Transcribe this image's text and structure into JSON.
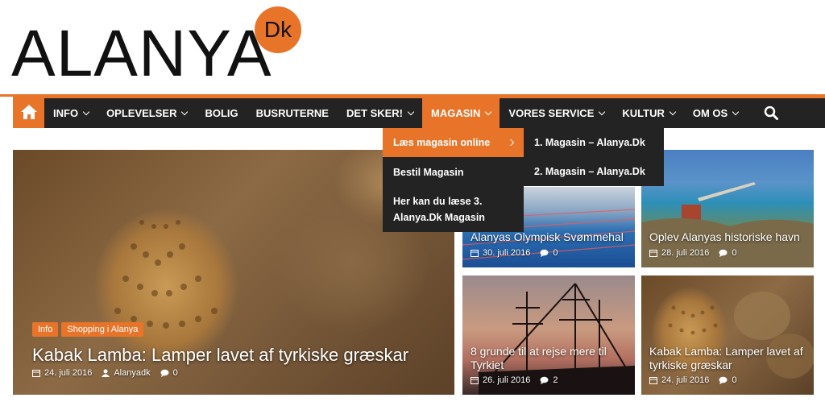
{
  "logo": {
    "text": "ALANYA",
    "badge": "Dk"
  },
  "colors": {
    "accent": "#e8742a",
    "nav_bg": "#232323"
  },
  "nav": {
    "home_icon": "home-icon",
    "items": [
      {
        "label": "INFO",
        "has_dropdown": true
      },
      {
        "label": "OPLEVELSER",
        "has_dropdown": true
      },
      {
        "label": "BOLIG",
        "has_dropdown": false
      },
      {
        "label": "BUSRUTERNE",
        "has_dropdown": false
      },
      {
        "label": "DET SKER!",
        "has_dropdown": true
      },
      {
        "label": "MAGASIN",
        "has_dropdown": true
      },
      {
        "label": "VORES SERVICE",
        "has_dropdown": true
      },
      {
        "label": "KULTUR",
        "has_dropdown": true
      },
      {
        "label": "OM OS",
        "has_dropdown": true
      }
    ],
    "search_icon": "search-icon"
  },
  "dropdown": {
    "items": [
      {
        "label": "Læs magasin online"
      },
      {
        "label": "Bestil Magasin"
      },
      {
        "label": "Her kan du læse 3. Alanya.Dk Magasin"
      }
    ],
    "submenu": [
      {
        "label": "1. Magasin – Alanya.Dk"
      },
      {
        "label": "2. Magasin – Alanya.Dk"
      }
    ]
  },
  "featured": {
    "categories": [
      "Info",
      "Shopping i Alanya"
    ],
    "title": "Kabak Lamba: Lamper lavet af tyrkiske græskar",
    "date": "24. juli 2016",
    "author": "Alanyadk",
    "comments": "0"
  },
  "tiles": [
    {
      "title": "Alanyas Olympisk Svømmehal",
      "date": "30. juli 2016",
      "comments": "0"
    },
    {
      "title": "Oplev Alanyas historiske havn",
      "date": "28. juli 2016",
      "comments": "0"
    },
    {
      "title": "8 grunde til at rejse mere til Tyrkiet",
      "date": "26. juli 2016",
      "comments": "2"
    },
    {
      "title": "Kabak Lamba: Lamper lavet af tyrkiske græskar",
      "date": "24. juli 2016",
      "comments": "0"
    }
  ]
}
